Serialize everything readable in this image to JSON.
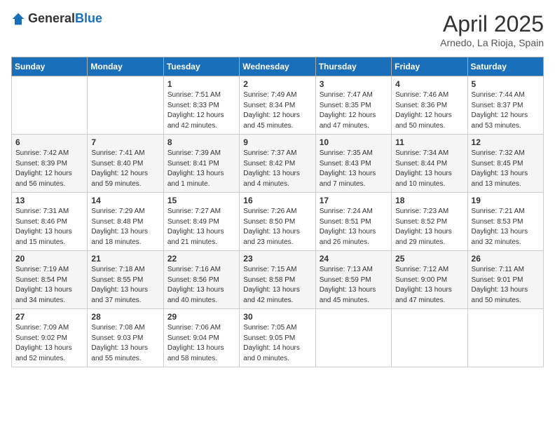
{
  "header": {
    "logo_general": "General",
    "logo_blue": "Blue",
    "month_title": "April 2025",
    "location": "Arnedo, La Rioja, Spain"
  },
  "days_of_week": [
    "Sunday",
    "Monday",
    "Tuesday",
    "Wednesday",
    "Thursday",
    "Friday",
    "Saturday"
  ],
  "weeks": [
    [
      {
        "day": "",
        "sunrise": "",
        "sunset": "",
        "daylight": ""
      },
      {
        "day": "",
        "sunrise": "",
        "sunset": "",
        "daylight": ""
      },
      {
        "day": "1",
        "sunrise": "Sunrise: 7:51 AM",
        "sunset": "Sunset: 8:33 PM",
        "daylight": "Daylight: 12 hours and 42 minutes."
      },
      {
        "day": "2",
        "sunrise": "Sunrise: 7:49 AM",
        "sunset": "Sunset: 8:34 PM",
        "daylight": "Daylight: 12 hours and 45 minutes."
      },
      {
        "day": "3",
        "sunrise": "Sunrise: 7:47 AM",
        "sunset": "Sunset: 8:35 PM",
        "daylight": "Daylight: 12 hours and 47 minutes."
      },
      {
        "day": "4",
        "sunrise": "Sunrise: 7:46 AM",
        "sunset": "Sunset: 8:36 PM",
        "daylight": "Daylight: 12 hours and 50 minutes."
      },
      {
        "day": "5",
        "sunrise": "Sunrise: 7:44 AM",
        "sunset": "Sunset: 8:37 PM",
        "daylight": "Daylight: 12 hours and 53 minutes."
      }
    ],
    [
      {
        "day": "6",
        "sunrise": "Sunrise: 7:42 AM",
        "sunset": "Sunset: 8:39 PM",
        "daylight": "Daylight: 12 hours and 56 minutes."
      },
      {
        "day": "7",
        "sunrise": "Sunrise: 7:41 AM",
        "sunset": "Sunset: 8:40 PM",
        "daylight": "Daylight: 12 hours and 59 minutes."
      },
      {
        "day": "8",
        "sunrise": "Sunrise: 7:39 AM",
        "sunset": "Sunset: 8:41 PM",
        "daylight": "Daylight: 13 hours and 1 minute."
      },
      {
        "day": "9",
        "sunrise": "Sunrise: 7:37 AM",
        "sunset": "Sunset: 8:42 PM",
        "daylight": "Daylight: 13 hours and 4 minutes."
      },
      {
        "day": "10",
        "sunrise": "Sunrise: 7:35 AM",
        "sunset": "Sunset: 8:43 PM",
        "daylight": "Daylight: 13 hours and 7 minutes."
      },
      {
        "day": "11",
        "sunrise": "Sunrise: 7:34 AM",
        "sunset": "Sunset: 8:44 PM",
        "daylight": "Daylight: 13 hours and 10 minutes."
      },
      {
        "day": "12",
        "sunrise": "Sunrise: 7:32 AM",
        "sunset": "Sunset: 8:45 PM",
        "daylight": "Daylight: 13 hours and 13 minutes."
      }
    ],
    [
      {
        "day": "13",
        "sunrise": "Sunrise: 7:31 AM",
        "sunset": "Sunset: 8:46 PM",
        "daylight": "Daylight: 13 hours and 15 minutes."
      },
      {
        "day": "14",
        "sunrise": "Sunrise: 7:29 AM",
        "sunset": "Sunset: 8:48 PM",
        "daylight": "Daylight: 13 hours and 18 minutes."
      },
      {
        "day": "15",
        "sunrise": "Sunrise: 7:27 AM",
        "sunset": "Sunset: 8:49 PM",
        "daylight": "Daylight: 13 hours and 21 minutes."
      },
      {
        "day": "16",
        "sunrise": "Sunrise: 7:26 AM",
        "sunset": "Sunset: 8:50 PM",
        "daylight": "Daylight: 13 hours and 23 minutes."
      },
      {
        "day": "17",
        "sunrise": "Sunrise: 7:24 AM",
        "sunset": "Sunset: 8:51 PM",
        "daylight": "Daylight: 13 hours and 26 minutes."
      },
      {
        "day": "18",
        "sunrise": "Sunrise: 7:23 AM",
        "sunset": "Sunset: 8:52 PM",
        "daylight": "Daylight: 13 hours and 29 minutes."
      },
      {
        "day": "19",
        "sunrise": "Sunrise: 7:21 AM",
        "sunset": "Sunset: 8:53 PM",
        "daylight": "Daylight: 13 hours and 32 minutes."
      }
    ],
    [
      {
        "day": "20",
        "sunrise": "Sunrise: 7:19 AM",
        "sunset": "Sunset: 8:54 PM",
        "daylight": "Daylight: 13 hours and 34 minutes."
      },
      {
        "day": "21",
        "sunrise": "Sunrise: 7:18 AM",
        "sunset": "Sunset: 8:55 PM",
        "daylight": "Daylight: 13 hours and 37 minutes."
      },
      {
        "day": "22",
        "sunrise": "Sunrise: 7:16 AM",
        "sunset": "Sunset: 8:56 PM",
        "daylight": "Daylight: 13 hours and 40 minutes."
      },
      {
        "day": "23",
        "sunrise": "Sunrise: 7:15 AM",
        "sunset": "Sunset: 8:58 PM",
        "daylight": "Daylight: 13 hours and 42 minutes."
      },
      {
        "day": "24",
        "sunrise": "Sunrise: 7:13 AM",
        "sunset": "Sunset: 8:59 PM",
        "daylight": "Daylight: 13 hours and 45 minutes."
      },
      {
        "day": "25",
        "sunrise": "Sunrise: 7:12 AM",
        "sunset": "Sunset: 9:00 PM",
        "daylight": "Daylight: 13 hours and 47 minutes."
      },
      {
        "day": "26",
        "sunrise": "Sunrise: 7:11 AM",
        "sunset": "Sunset: 9:01 PM",
        "daylight": "Daylight: 13 hours and 50 minutes."
      }
    ],
    [
      {
        "day": "27",
        "sunrise": "Sunrise: 7:09 AM",
        "sunset": "Sunset: 9:02 PM",
        "daylight": "Daylight: 13 hours and 52 minutes."
      },
      {
        "day": "28",
        "sunrise": "Sunrise: 7:08 AM",
        "sunset": "Sunset: 9:03 PM",
        "daylight": "Daylight: 13 hours and 55 minutes."
      },
      {
        "day": "29",
        "sunrise": "Sunrise: 7:06 AM",
        "sunset": "Sunset: 9:04 PM",
        "daylight": "Daylight: 13 hours and 58 minutes."
      },
      {
        "day": "30",
        "sunrise": "Sunrise: 7:05 AM",
        "sunset": "Sunset: 9:05 PM",
        "daylight": "Daylight: 14 hours and 0 minutes."
      },
      {
        "day": "",
        "sunrise": "",
        "sunset": "",
        "daylight": ""
      },
      {
        "day": "",
        "sunrise": "",
        "sunset": "",
        "daylight": ""
      },
      {
        "day": "",
        "sunrise": "",
        "sunset": "",
        "daylight": ""
      }
    ]
  ]
}
